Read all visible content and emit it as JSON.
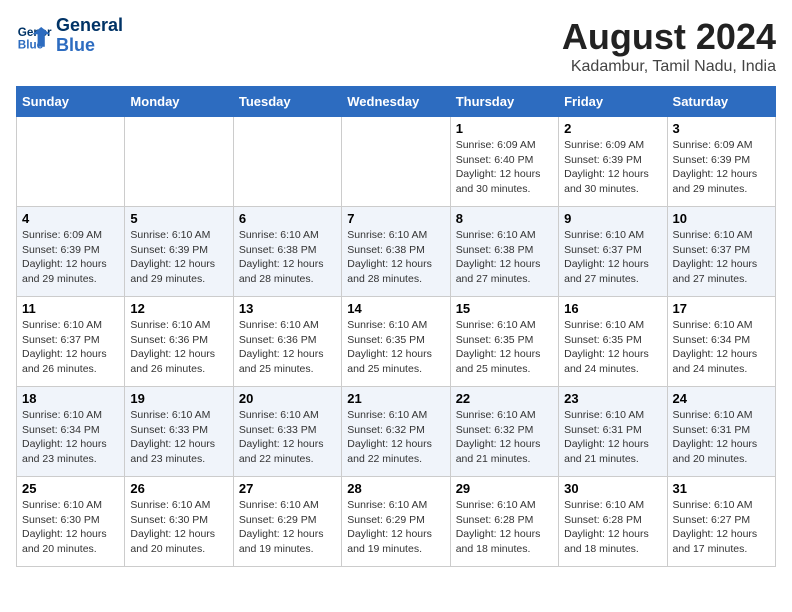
{
  "header": {
    "logo_line1": "General",
    "logo_line2": "Blue",
    "main_title": "August 2024",
    "subtitle": "Kadambur, Tamil Nadu, India"
  },
  "days_of_week": [
    "Sunday",
    "Monday",
    "Tuesday",
    "Wednesday",
    "Thursday",
    "Friday",
    "Saturday"
  ],
  "weeks": [
    [
      {
        "day": "",
        "info": ""
      },
      {
        "day": "",
        "info": ""
      },
      {
        "day": "",
        "info": ""
      },
      {
        "day": "",
        "info": ""
      },
      {
        "day": "1",
        "info": "Sunrise: 6:09 AM\nSunset: 6:40 PM\nDaylight: 12 hours\nand 30 minutes."
      },
      {
        "day": "2",
        "info": "Sunrise: 6:09 AM\nSunset: 6:39 PM\nDaylight: 12 hours\nand 30 minutes."
      },
      {
        "day": "3",
        "info": "Sunrise: 6:09 AM\nSunset: 6:39 PM\nDaylight: 12 hours\nand 29 minutes."
      }
    ],
    [
      {
        "day": "4",
        "info": "Sunrise: 6:09 AM\nSunset: 6:39 PM\nDaylight: 12 hours\nand 29 minutes."
      },
      {
        "day": "5",
        "info": "Sunrise: 6:10 AM\nSunset: 6:39 PM\nDaylight: 12 hours\nand 29 minutes."
      },
      {
        "day": "6",
        "info": "Sunrise: 6:10 AM\nSunset: 6:38 PM\nDaylight: 12 hours\nand 28 minutes."
      },
      {
        "day": "7",
        "info": "Sunrise: 6:10 AM\nSunset: 6:38 PM\nDaylight: 12 hours\nand 28 minutes."
      },
      {
        "day": "8",
        "info": "Sunrise: 6:10 AM\nSunset: 6:38 PM\nDaylight: 12 hours\nand 27 minutes."
      },
      {
        "day": "9",
        "info": "Sunrise: 6:10 AM\nSunset: 6:37 PM\nDaylight: 12 hours\nand 27 minutes."
      },
      {
        "day": "10",
        "info": "Sunrise: 6:10 AM\nSunset: 6:37 PM\nDaylight: 12 hours\nand 27 minutes."
      }
    ],
    [
      {
        "day": "11",
        "info": "Sunrise: 6:10 AM\nSunset: 6:37 PM\nDaylight: 12 hours\nand 26 minutes."
      },
      {
        "day": "12",
        "info": "Sunrise: 6:10 AM\nSunset: 6:36 PM\nDaylight: 12 hours\nand 26 minutes."
      },
      {
        "day": "13",
        "info": "Sunrise: 6:10 AM\nSunset: 6:36 PM\nDaylight: 12 hours\nand 25 minutes."
      },
      {
        "day": "14",
        "info": "Sunrise: 6:10 AM\nSunset: 6:35 PM\nDaylight: 12 hours\nand 25 minutes."
      },
      {
        "day": "15",
        "info": "Sunrise: 6:10 AM\nSunset: 6:35 PM\nDaylight: 12 hours\nand 25 minutes."
      },
      {
        "day": "16",
        "info": "Sunrise: 6:10 AM\nSunset: 6:35 PM\nDaylight: 12 hours\nand 24 minutes."
      },
      {
        "day": "17",
        "info": "Sunrise: 6:10 AM\nSunset: 6:34 PM\nDaylight: 12 hours\nand 24 minutes."
      }
    ],
    [
      {
        "day": "18",
        "info": "Sunrise: 6:10 AM\nSunset: 6:34 PM\nDaylight: 12 hours\nand 23 minutes."
      },
      {
        "day": "19",
        "info": "Sunrise: 6:10 AM\nSunset: 6:33 PM\nDaylight: 12 hours\nand 23 minutes."
      },
      {
        "day": "20",
        "info": "Sunrise: 6:10 AM\nSunset: 6:33 PM\nDaylight: 12 hours\nand 22 minutes."
      },
      {
        "day": "21",
        "info": "Sunrise: 6:10 AM\nSunset: 6:32 PM\nDaylight: 12 hours\nand 22 minutes."
      },
      {
        "day": "22",
        "info": "Sunrise: 6:10 AM\nSunset: 6:32 PM\nDaylight: 12 hours\nand 21 minutes."
      },
      {
        "day": "23",
        "info": "Sunrise: 6:10 AM\nSunset: 6:31 PM\nDaylight: 12 hours\nand 21 minutes."
      },
      {
        "day": "24",
        "info": "Sunrise: 6:10 AM\nSunset: 6:31 PM\nDaylight: 12 hours\nand 20 minutes."
      }
    ],
    [
      {
        "day": "25",
        "info": "Sunrise: 6:10 AM\nSunset: 6:30 PM\nDaylight: 12 hours\nand 20 minutes."
      },
      {
        "day": "26",
        "info": "Sunrise: 6:10 AM\nSunset: 6:30 PM\nDaylight: 12 hours\nand 20 minutes."
      },
      {
        "day": "27",
        "info": "Sunrise: 6:10 AM\nSunset: 6:29 PM\nDaylight: 12 hours\nand 19 minutes."
      },
      {
        "day": "28",
        "info": "Sunrise: 6:10 AM\nSunset: 6:29 PM\nDaylight: 12 hours\nand 19 minutes."
      },
      {
        "day": "29",
        "info": "Sunrise: 6:10 AM\nSunset: 6:28 PM\nDaylight: 12 hours\nand 18 minutes."
      },
      {
        "day": "30",
        "info": "Sunrise: 6:10 AM\nSunset: 6:28 PM\nDaylight: 12 hours\nand 18 minutes."
      },
      {
        "day": "31",
        "info": "Sunrise: 6:10 AM\nSunset: 6:27 PM\nDaylight: 12 hours\nand 17 minutes."
      }
    ]
  ]
}
